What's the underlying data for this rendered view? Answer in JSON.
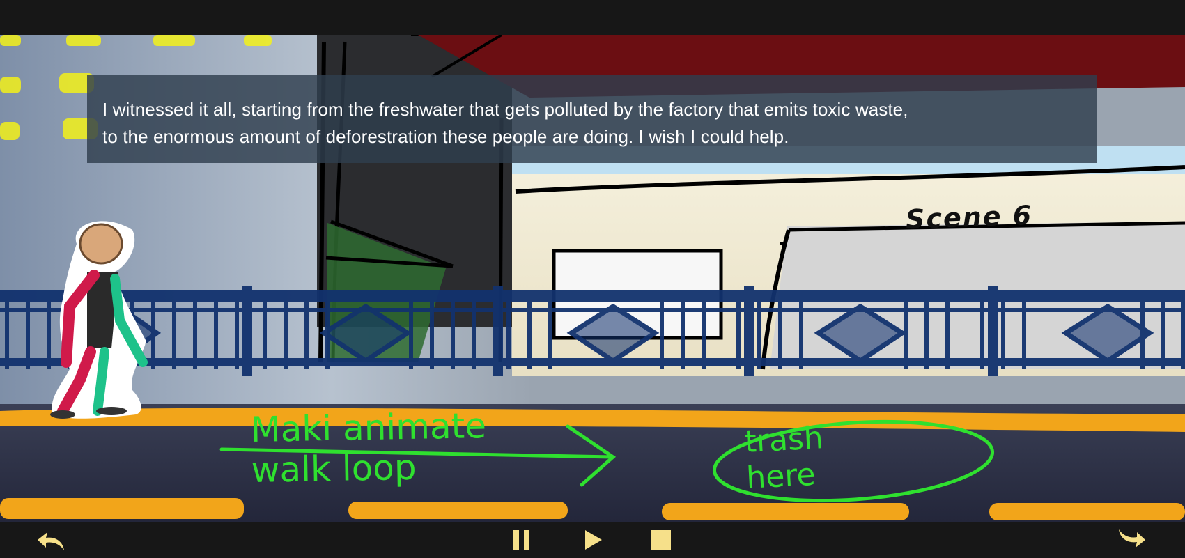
{
  "caption": {
    "line1": "I witnessed it all, starting from the freshwater that gets polluted by the factory that emits toxic waste,",
    "line2": "to the enormous amount of deforestration these people are doing. I wish I could help."
  },
  "scene_label": "Scene 6",
  "sketch_notes": {
    "walk": "Maki animate\nwalk loop",
    "trash": "trash\nhere"
  },
  "controls": {
    "back_icon": "curved-back-arrow",
    "pause_icon": "pause",
    "play_icon": "play",
    "stop_icon": "stop",
    "forward_icon": "curved-forward-arrow"
  },
  "colors": {
    "control_icon": "#f6e08a",
    "rail": "#12326e",
    "sketch_note": "#2fe02f",
    "curb": "#f2a51a"
  }
}
